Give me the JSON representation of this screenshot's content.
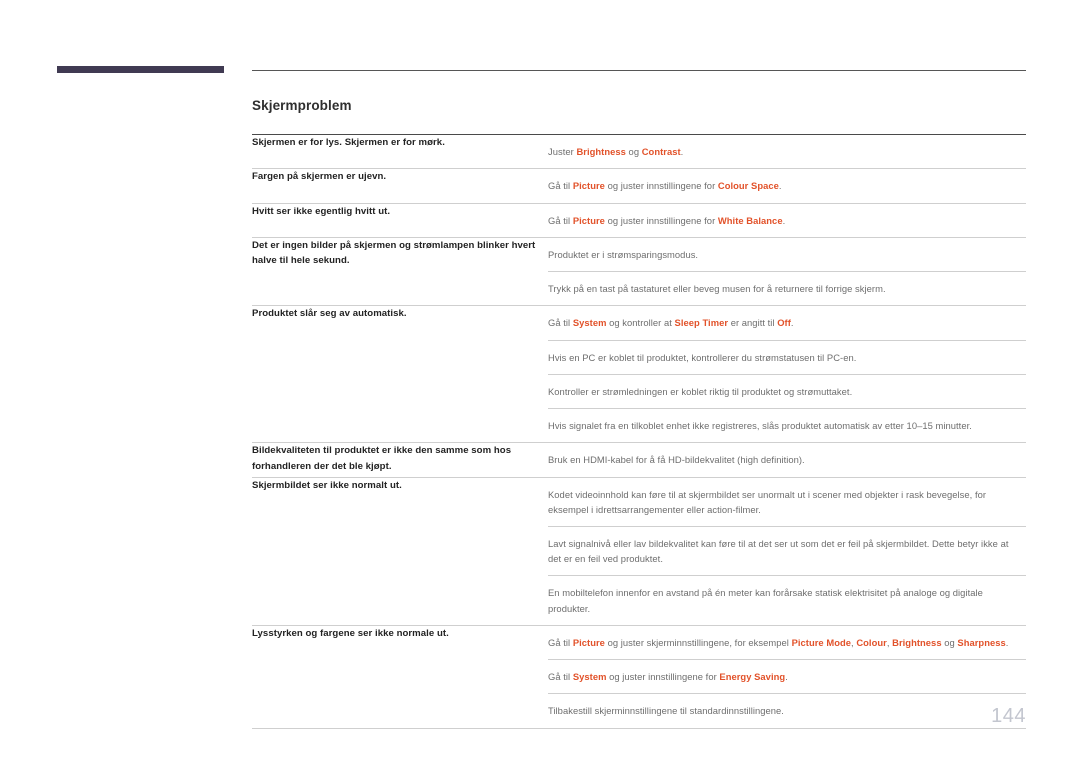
{
  "page": {
    "number": "144",
    "section_title": "Skjermproblem"
  },
  "table": {
    "rows": [
      {
        "problem": "Skjermen er for lys. Skjermen er for mørk.",
        "solutions": [
          [
            {
              "t": "Juster ",
              "hl": false
            },
            {
              "t": "Brightness",
              "hl": true
            },
            {
              "t": " og ",
              "hl": false
            },
            {
              "t": "Contrast",
              "hl": true
            },
            {
              "t": ".",
              "hl": false
            }
          ]
        ]
      },
      {
        "problem": "Fargen på skjermen er ujevn.",
        "solutions": [
          [
            {
              "t": "Gå til ",
              "hl": false
            },
            {
              "t": "Picture",
              "hl": true
            },
            {
              "t": " og juster innstillingene for ",
              "hl": false
            },
            {
              "t": "Colour Space",
              "hl": true
            },
            {
              "t": ".",
              "hl": false
            }
          ]
        ]
      },
      {
        "problem": "Hvitt ser ikke egentlig hvitt ut.",
        "solutions": [
          [
            {
              "t": "Gå til ",
              "hl": false
            },
            {
              "t": "Picture",
              "hl": true
            },
            {
              "t": " og juster innstillingene for ",
              "hl": false
            },
            {
              "t": "White Balance",
              "hl": true
            },
            {
              "t": ".",
              "hl": false
            }
          ]
        ]
      },
      {
        "problem": "Det er ingen bilder på skjermen og strømlampen blinker hvert halve til hele sekund.",
        "solutions": [
          [
            {
              "t": "Produktet er i strømsparingsmodus.",
              "hl": false
            }
          ],
          [
            {
              "t": "Trykk på en tast på tastaturet eller beveg musen for å returnere til forrige skjerm.",
              "hl": false
            }
          ]
        ]
      },
      {
        "problem": "Produktet slår seg av automatisk.",
        "solutions": [
          [
            {
              "t": "Gå til ",
              "hl": false
            },
            {
              "t": "System",
              "hl": true
            },
            {
              "t": " og kontroller at ",
              "hl": false
            },
            {
              "t": "Sleep Timer",
              "hl": true
            },
            {
              "t": " er angitt til ",
              "hl": false
            },
            {
              "t": "Off",
              "hl": true
            },
            {
              "t": ".",
              "hl": false
            }
          ],
          [
            {
              "t": "Hvis en PC er koblet til produktet, kontrollerer du strømstatusen til PC-en.",
              "hl": false
            }
          ],
          [
            {
              "t": "Kontroller er strømledningen er koblet riktig til produktet og strømuttaket.",
              "hl": false
            }
          ],
          [
            {
              "t": "Hvis signalet fra en tilkoblet enhet ikke registreres, slås produktet automatisk av etter 10–15 minutter.",
              "hl": false
            }
          ]
        ]
      },
      {
        "problem": "Bildekvaliteten til produktet er ikke den samme som hos forhandleren der det ble kjøpt.",
        "solutions": [
          [
            {
              "t": "Bruk en HDMI-kabel for å få HD-bildekvalitet (high definition).",
              "hl": false
            }
          ]
        ]
      },
      {
        "problem": "Skjermbildet ser ikke normalt ut.",
        "solutions": [
          [
            {
              "t": "Kodet videoinnhold kan føre til at skjermbildet ser unormalt ut i scener med objekter i rask bevegelse, for eksempel i idrettsarrangementer eller action-filmer.",
              "hl": false
            }
          ],
          [
            {
              "t": "Lavt signalnivå eller lav bildekvalitet kan føre til at det ser ut som det er feil på skjermbildet. Dette betyr ikke at det er en feil ved produktet.",
              "hl": false
            }
          ],
          [
            {
              "t": "En mobiltelefon innenfor en avstand på én meter kan forårsake statisk elektrisitet på analoge og digitale produkter.",
              "hl": false
            }
          ]
        ]
      },
      {
        "problem": "Lysstyrken og fargene ser ikke normale ut.",
        "solutions": [
          [
            {
              "t": "Gå til ",
              "hl": false
            },
            {
              "t": "Picture",
              "hl": true
            },
            {
              "t": " og juster skjerminnstillingene, for eksempel ",
              "hl": false
            },
            {
              "t": "Picture Mode",
              "hl": true
            },
            {
              "t": ", ",
              "hl": false
            },
            {
              "t": "Colour",
              "hl": true
            },
            {
              "t": ", ",
              "hl": false
            },
            {
              "t": "Brightness",
              "hl": true
            },
            {
              "t": " og ",
              "hl": false
            },
            {
              "t": "Sharpness",
              "hl": true
            },
            {
              "t": ".",
              "hl": false
            }
          ],
          [
            {
              "t": "Gå til ",
              "hl": false
            },
            {
              "t": "System",
              "hl": true
            },
            {
              "t": " og juster innstillingene for ",
              "hl": false
            },
            {
              "t": "Energy Saving",
              "hl": true
            },
            {
              "t": ".",
              "hl": false
            }
          ],
          [
            {
              "t": "Tilbakestill skjerminnstillingene til standardinnstillingene.",
              "hl": false
            }
          ]
        ]
      }
    ]
  },
  "colors": {
    "highlight": "#e2522a",
    "deco_bar": "#403a52",
    "page_number": "#c3c6cf",
    "rule": "#cfcfcf"
  }
}
